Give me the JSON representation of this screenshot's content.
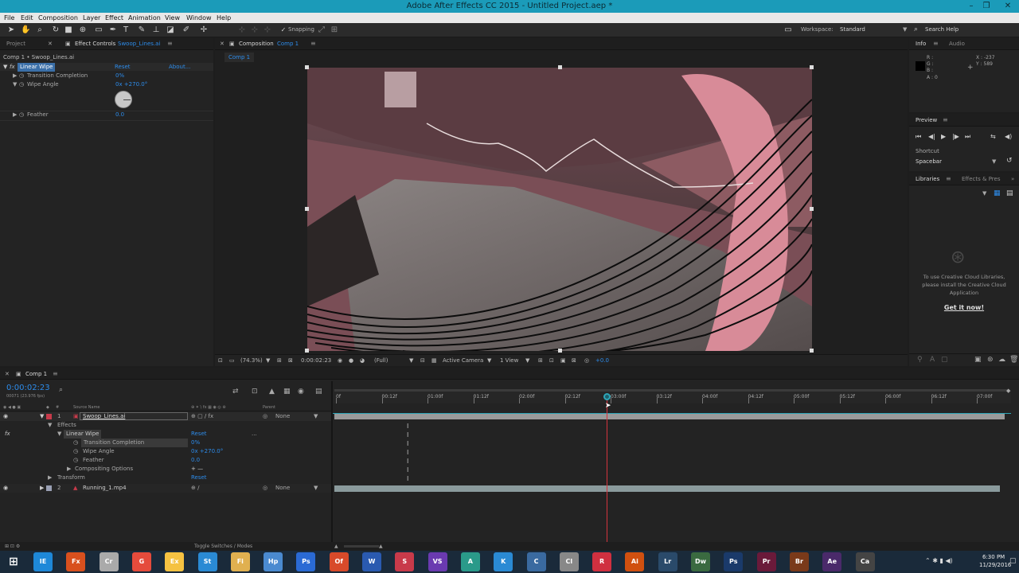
{
  "window": {
    "title": "Adobe After Effects CC 2015 - Untitled Project.aep *",
    "min": "–",
    "max": "❐",
    "close": "✕"
  },
  "menu": [
    "File",
    "Edit",
    "Composition",
    "Layer",
    "Effect",
    "Animation",
    "View",
    "Window",
    "Help"
  ],
  "toolbar": {
    "snapping": "Snapping",
    "workspace_label": "Workspace:",
    "workspace_value": "Standard",
    "search_placeholder": "Search Help"
  },
  "left_panel": {
    "tab_project": "Project",
    "tab_effect_controls": "Effect Controls",
    "tab_effect_layer": "Swoop_Lines.ai",
    "breadcrumb": "Comp 1 • Swoop_Lines.ai",
    "effect_name": "Linear Wipe",
    "reset": "Reset",
    "about": "About...",
    "props": [
      {
        "name": "Transition Completion",
        "value": "0%"
      },
      {
        "name": "Wipe Angle",
        "value": "0x +270.0°"
      },
      {
        "name": "Feather",
        "value": "0.0"
      }
    ]
  },
  "comp_panel": {
    "tab": "Composition",
    "tab_comp": "Comp 1",
    "sub_tab": "Comp 1",
    "footer": {
      "zoom": "(74.3%)",
      "timecode": "0:00:02:23",
      "resolution": "(Full)",
      "camera": "Active Camera",
      "views": "1 View",
      "exposure": "+0.0"
    }
  },
  "info_panel": {
    "tab_info": "Info",
    "tab_audio": "Audio",
    "r": "R :",
    "g": "G :",
    "b": "B :",
    "a": "A : 0",
    "x": "X : -237",
    "y": "Y : 589"
  },
  "preview_panel": {
    "title": "Preview",
    "shortcut_label": "Shortcut",
    "shortcut_value": "Spacebar"
  },
  "libraries_panel": {
    "tab_libraries": "Libraries",
    "tab_effects": "Effects & Pres",
    "message": [
      "To use Creative Cloud Libraries,",
      "please install the Creative Cloud",
      "Application"
    ],
    "link": "Get it now!"
  },
  "timeline": {
    "tab": "Comp 1",
    "timecode": "0:00:02:23",
    "fps": "00071 (23.976 fps)",
    "col_source": "Source Name",
    "col_parent": "Parent",
    "ruler": [
      "0f",
      "00:12f",
      "01:00f",
      "01:12f",
      "02:00f",
      "02:12f",
      "03:00f",
      "03:12f",
      "04:00f",
      "04:12f",
      "05:00f",
      "05:12f",
      "06:00f",
      "06:12f",
      "07:00f"
    ],
    "layers": [
      {
        "num": "1",
        "name": "Swoop_Lines.ai",
        "parent": "None"
      },
      {
        "num": "2",
        "name": "Running_1.mp4",
        "parent": "None"
      }
    ],
    "props": {
      "effects": "Effects",
      "linear_wipe": "Linear Wipe",
      "linear_wipe_reset": "Reset",
      "linear_wipe_more": "...",
      "transition": "Transition Completion",
      "transition_value": "0%",
      "wipe_angle": "Wipe Angle",
      "wipe_angle_value": "0x +270.0°",
      "feather": "Feather",
      "feather_value": "0.0",
      "compositing": "Compositing Options",
      "compositing_value": "+ —",
      "transform": "Transform",
      "transform_reset": "Reset"
    },
    "footer": "Toggle Switches / Modes",
    "playhead_time": "0:00:02:23"
  },
  "taskbar": {
    "time": "6:30 PM",
    "date": "11/29/2016",
    "apps": [
      "IE",
      "Fx",
      "Cr",
      "G",
      "Ex",
      "St",
      "Fi",
      "Hp",
      "Ps",
      "Of",
      "W",
      "S",
      "VS",
      "A",
      "K",
      "C",
      "Cl",
      "R",
      "Ai",
      "Lr",
      "Dw",
      "Ps",
      "Pr",
      "Br",
      "Ae",
      "Ca"
    ]
  },
  "colors": {
    "accent": "#2d8ceb",
    "title_bar": "#1b9bb9",
    "playhead": "#d4343d",
    "layer_label": "#c83a4a"
  }
}
